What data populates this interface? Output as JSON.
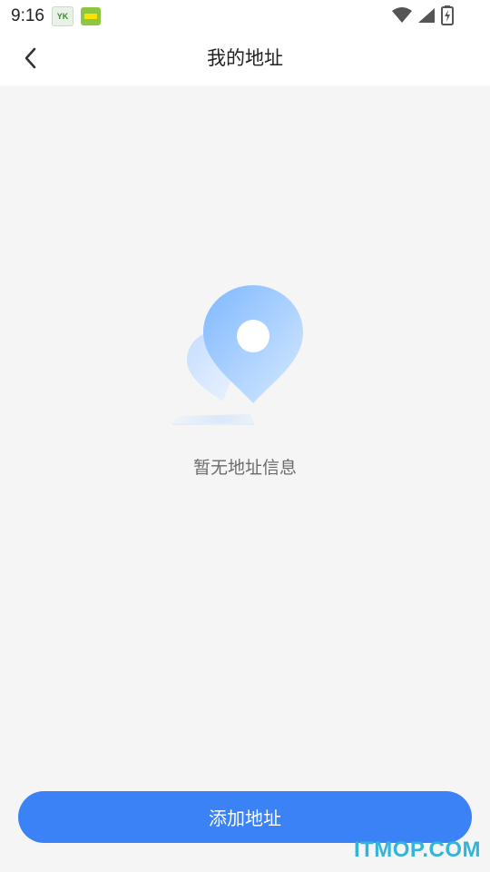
{
  "status_bar": {
    "time": "9:16",
    "notification_icons": [
      "yk-app-icon",
      "green-app-icon"
    ],
    "system_icons": [
      "wifi-icon",
      "cellular-signal-icon",
      "battery-charging-icon"
    ]
  },
  "header": {
    "title": "我的地址",
    "back_icon": "chevron-left-icon"
  },
  "empty_state": {
    "illustration": "location-pin-icon",
    "message": "暂无地址信息"
  },
  "footer": {
    "add_button_label": "添加地址"
  },
  "watermark": {
    "text": "ITMOP.COM"
  },
  "colors": {
    "accent": "#3b82f6",
    "background": "#f5f5f5",
    "pin_light": "#c9e1ff",
    "pin_main": "#8ec2ff",
    "watermark": "#32b5d8"
  }
}
